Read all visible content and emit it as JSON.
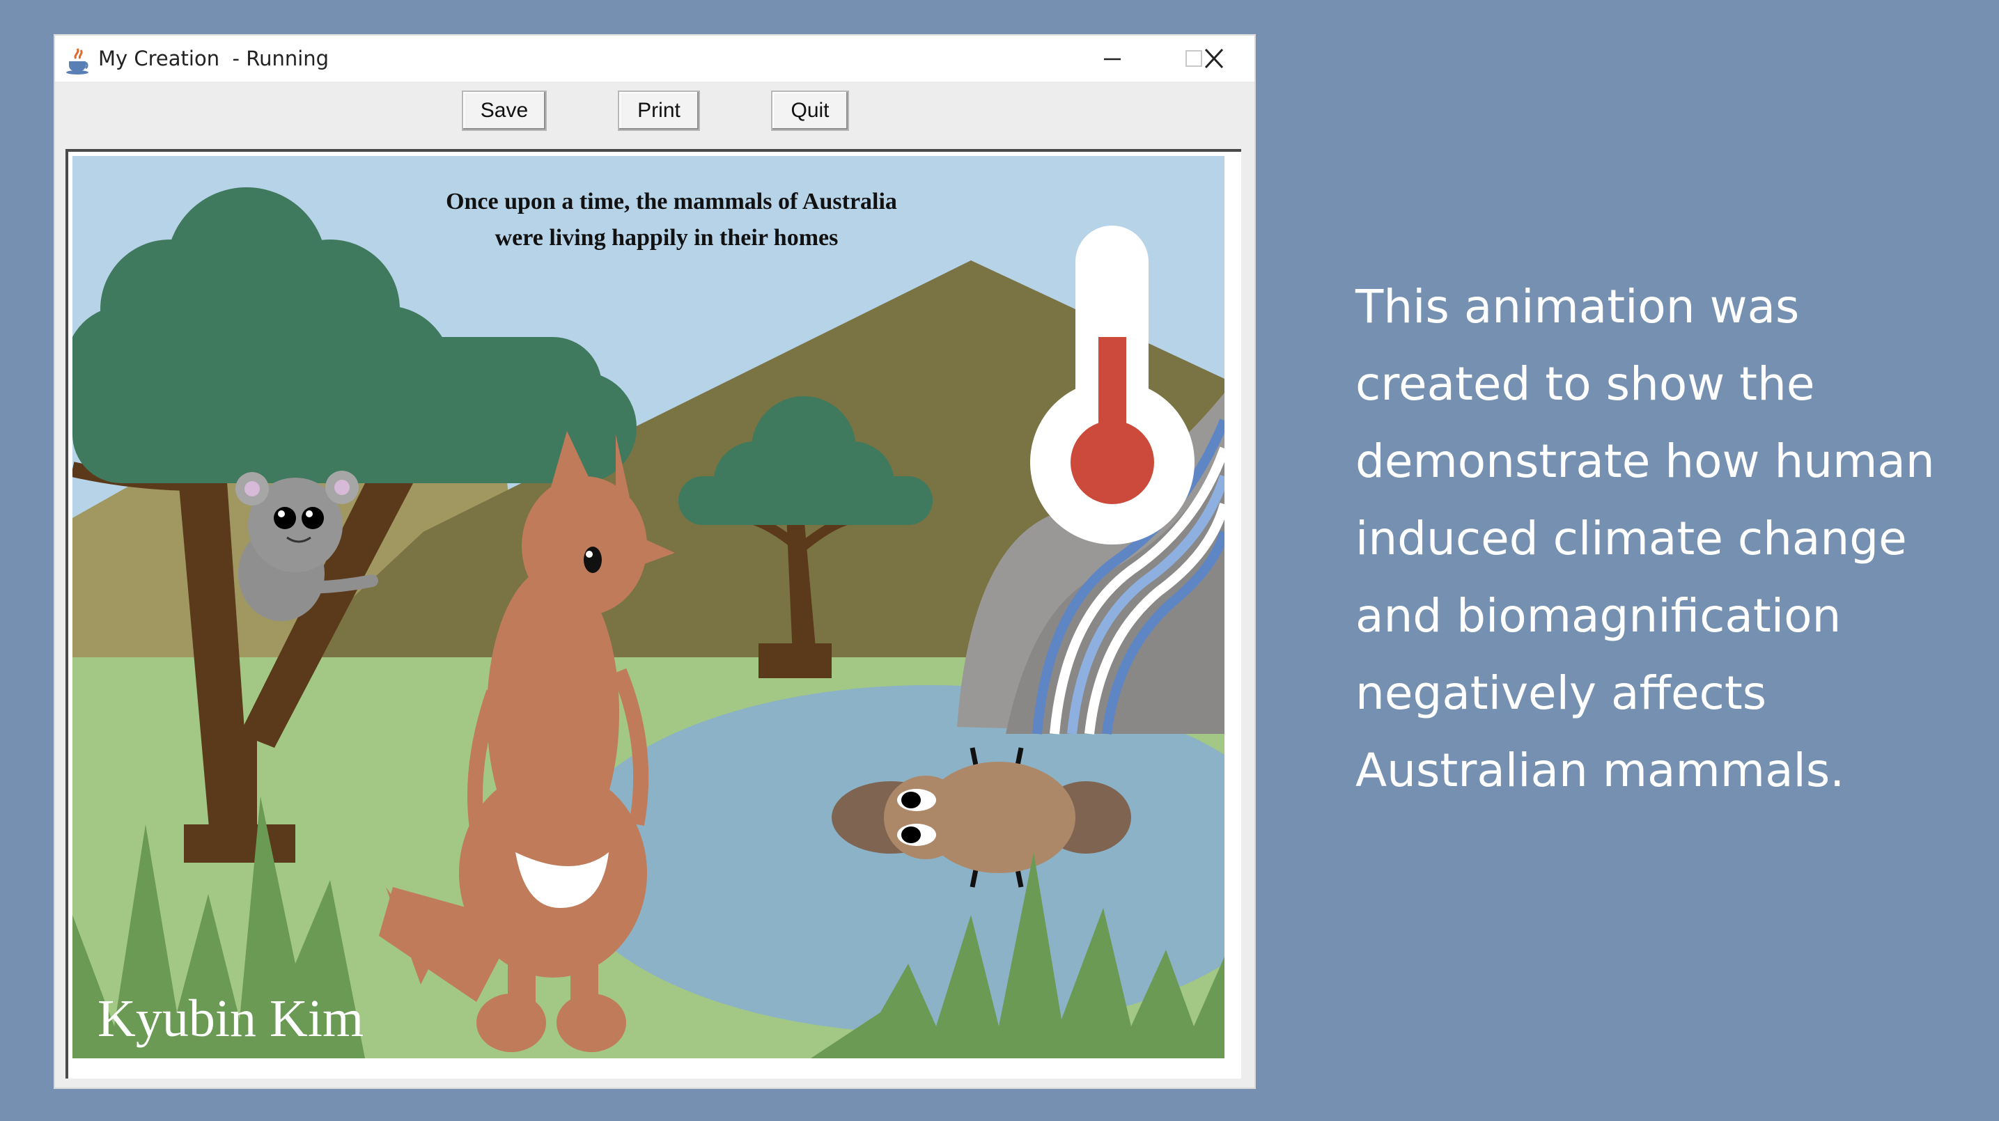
{
  "window": {
    "title": "My Creation  - Running",
    "icon": "java-cup-icon",
    "controls": {
      "minimize": "minimize-icon",
      "maximize": "maximize-icon",
      "close": "close-icon"
    }
  },
  "toolbar": {
    "save_label": "Save",
    "print_label": "Print",
    "quit_label": "Quit"
  },
  "scene": {
    "caption_line1": "Once upon a time, the mammals of Australia",
    "caption_line2": "were living happily in their homes",
    "signature": "Kyubin Kim"
  },
  "description": {
    "text": "This animation was created to show the demonstrate how human induced climate change and biomagnification negatively affects Australian mammals."
  },
  "colors": {
    "background": "#7590b0",
    "sky": "#b7d3e8",
    "grass": "#a3c785",
    "tree_foliage": "#3f7a5e",
    "kangaroo": "#c07b5a",
    "thermometer_red": "#cc4a3c"
  }
}
